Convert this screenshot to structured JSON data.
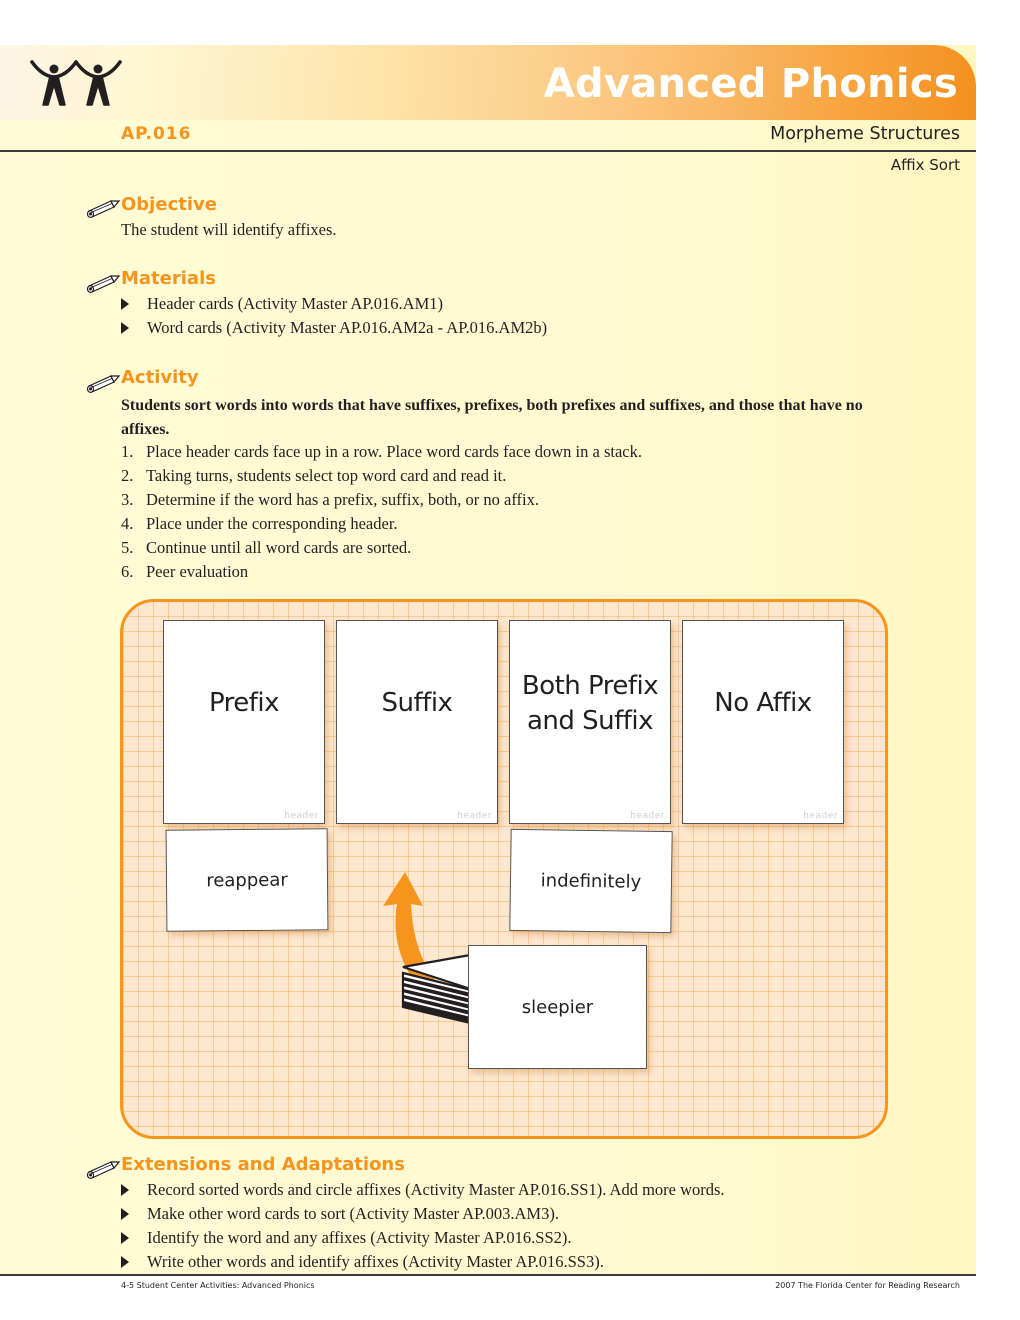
{
  "header": {
    "title": "Advanced Phonics",
    "code": "AP.016",
    "strand": "Morpheme Structures",
    "subtitle": "Affix Sort",
    "logo_icon": "two-people-icon",
    "accent_color": "#f7941d"
  },
  "objective": {
    "heading": "Objective",
    "icon": "pencil-icon",
    "text": "The student will identify affixes."
  },
  "materials": {
    "heading": "Materials",
    "icon": "pencil-icon",
    "items": [
      "Header cards (Activity Master AP.016.AM1)",
      "Word cards (Activity Master AP.016.AM2a - AP.016.AM2b)"
    ]
  },
  "activity": {
    "heading": "Activity",
    "icon": "pencil-icon",
    "intro": "Students sort words into words that have suffixes, prefixes, both prefixes and suffixes, and those that have no affixes.",
    "steps": [
      {
        "num": "1.",
        "text": "Place header cards face up in a row. Place word cards face down in a stack."
      },
      {
        "num": "2.",
        "text": "Taking turns, students select top word card and read it."
      },
      {
        "num": "3.",
        "text": "Determine if the word has a prefix, suffix, both, or no affix."
      },
      {
        "num": "4.",
        "text": "Place under the corresponding header."
      },
      {
        "num": "5.",
        "text": "Continue until all word cards are sorted."
      },
      {
        "num": "6.",
        "text": "Peer evaluation"
      }
    ]
  },
  "illustration": {
    "header_cards": [
      {
        "label": "Prefix",
        "tag": "header"
      },
      {
        "label": "Suffix",
        "tag": "header"
      },
      {
        "label": "Both Prefix and Suffix",
        "tag": "header"
      },
      {
        "label": "No Affix",
        "tag": "header"
      }
    ],
    "word_cards": [
      {
        "word": "reappear"
      },
      {
        "word": "indefinitely"
      },
      {
        "word": "sleepier"
      }
    ],
    "arrow_icon": "curved-arrow-icon",
    "stack_icon": "card-stack-icon"
  },
  "extensions": {
    "heading": "Extensions and Adaptations",
    "icon": "pencil-icon",
    "items": [
      "Record sorted words and circle affixes (Activity Master AP.016.SS1). Add more words.",
      "Make other word cards to sort (Activity Master AP.003.AM3).",
      "Identify the word and any affixes (Activity Master AP.016.SS2).",
      "Write other words and identify affixes (Activity Master AP.016.SS3)."
    ]
  },
  "footer": {
    "left": "4-5 Student Center Activities: Advanced Phonics",
    "right": "2007 The Florida Center for Reading Research"
  }
}
